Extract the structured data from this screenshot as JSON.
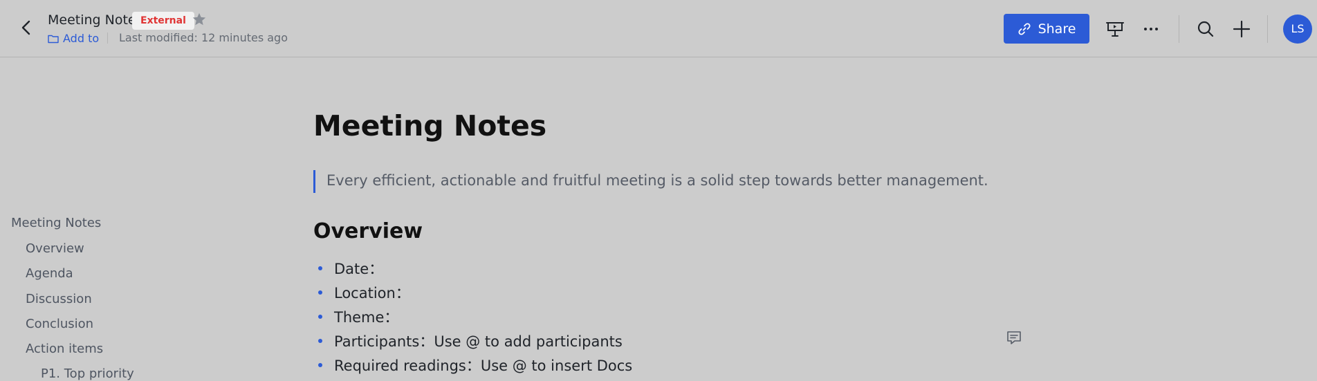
{
  "header": {
    "doc_title": "Meeting Notes",
    "badge": "External",
    "add_to": "Add to",
    "last_modified": "Last modified: 12 minutes ago",
    "share_label": "Share",
    "avatar_initials": "LS",
    "accent_color": "#2c5bd6",
    "icons": [
      "back-arrow-icon",
      "star-icon",
      "folder-icon",
      "link-icon",
      "present-icon",
      "more-icon",
      "search-icon",
      "plus-icon"
    ]
  },
  "outline": {
    "items": [
      {
        "label": "Meeting Notes"
      },
      {
        "label": "Overview"
      },
      {
        "label": "Agenda"
      },
      {
        "label": "Discussion"
      },
      {
        "label": "Conclusion"
      },
      {
        "label": "Action items"
      },
      {
        "label": "P1. Top priority"
      }
    ]
  },
  "document": {
    "title": "Meeting Notes",
    "quote": "Every efficient, actionable and fruitful meeting is a solid step towards better management.",
    "overview_heading": "Overview",
    "bullets": [
      "Date：",
      "Location：",
      "Theme：",
      "Participants：Use @ to add participants",
      "Required readings：Use @ to insert Docs"
    ]
  }
}
